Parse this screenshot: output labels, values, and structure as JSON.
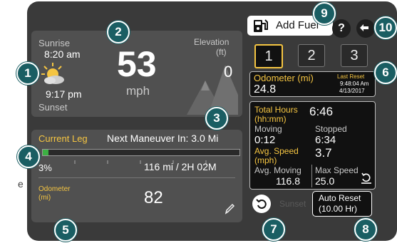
{
  "callouts": [
    "1",
    "2",
    "3",
    "4",
    "5",
    "6",
    "7",
    "8",
    "9",
    "10"
  ],
  "sun": {
    "sunrise_label": "Sunrise",
    "sunrise_time": "8:20 am",
    "sunset_time": "9:17 pm",
    "sunset_label": "Sunset"
  },
  "speed": {
    "value": "53",
    "unit": "mph"
  },
  "elevation": {
    "label": "Elevation",
    "unit": "(ft)",
    "value": "0"
  },
  "leg": {
    "title": "Current Leg",
    "next_maneuver": "Next Maneuver In: 3.0 Mi",
    "progress_text": "3%",
    "remaining": "116 mi / 2H 02M",
    "progress_fraction": 0.03
  },
  "odometer_left": {
    "label_line1": "Odometer",
    "label_line2": "(mi)",
    "value": "82"
  },
  "header": {
    "add_fuel_label": "Add Fuel",
    "help_label": "?"
  },
  "trips": {
    "items": [
      "1",
      "2",
      "3"
    ],
    "selected": 0
  },
  "trip_odometer": {
    "label": "Odometer (mi)",
    "value": "24.8",
    "last_reset_label": "Last Reset",
    "last_reset_time": "9:48:04 Am",
    "last_reset_date": "4/13/2017"
  },
  "stats": {
    "total_hours_label": "Total Hours",
    "total_hours_unit": "(hh:mm)",
    "total_hours_value": "6:46",
    "moving_label": "Moving",
    "moving_value": "0:12",
    "stopped_label": "Stopped",
    "stopped_value": "6:34",
    "avg_speed_label": "Avg. Speed",
    "avg_speed_unit": "(mph)",
    "avg_speed_value": "3.7",
    "avg_moving_label": "Avg. Moving",
    "avg_moving_value": "116.8",
    "max_speed_label": "Max Speed",
    "max_speed_value": "25.0"
  },
  "footer": {
    "faded_label": "Sunset",
    "auto_reset_line1": "Auto Reset",
    "auto_reset_line2": "(10.00 Hr)"
  },
  "side_label": "e",
  "colors": {
    "callout": "#1a5e63",
    "accent": "#f5c542",
    "panel": "#505050",
    "progress": "#3cb043"
  }
}
